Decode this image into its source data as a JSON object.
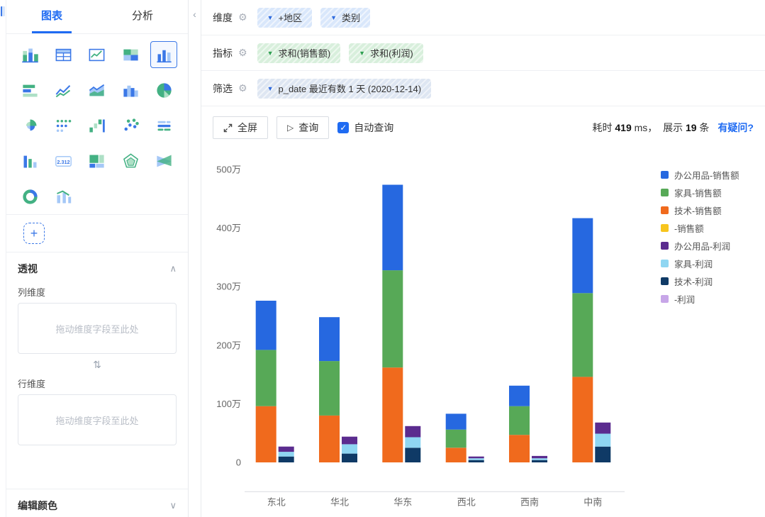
{
  "ui_icons": {
    "gear": "⚙",
    "dropdown": "▼",
    "collapse": "‹",
    "chevron_up": "∧",
    "chevron_down": "∨",
    "swap": "⇅",
    "plus": "+",
    "play": "▷",
    "check": "✓"
  },
  "sidebar": {
    "tabs": [
      {
        "label": "图表"
      },
      {
        "label": "分析"
      }
    ],
    "icons": [
      "stacked-bar-icon",
      "table-icon",
      "trend-table-icon",
      "grid-table-icon",
      "column-chart-icon",
      "bar-horizontal-icon",
      "line-chart-icon",
      "area-chart-icon",
      "histogram-icon",
      "pie-chart-icon",
      "rose-chart-icon",
      "dot-matrix-icon",
      "waterfall-icon",
      "scatter-icon",
      "word-cloud-icon",
      "rank-chart-icon",
      "number-card-icon",
      "treemap-icon",
      "radar-icon",
      "sankey-icon",
      "donut-chart-icon",
      "combo-chart-icon"
    ],
    "selected_index": 4,
    "number_card_text": "2.312",
    "pivot_title": "透视",
    "col_dim_label": "列维度",
    "col_dropzone": "拖动维度字段至此处",
    "row_dim_label": "行维度",
    "row_dropzone": "拖动维度字段至此处",
    "edit_color_label": "编辑颜色"
  },
  "fields": {
    "dimension": {
      "label": "维度",
      "pills": [
        {
          "text": "+地区"
        },
        {
          "text": "类别"
        }
      ]
    },
    "measure": {
      "label": "指标",
      "pills": [
        {
          "text": "求和(销售额)"
        },
        {
          "text": "求和(利润)"
        }
      ]
    },
    "filter": {
      "label": "筛选",
      "pills": [
        {
          "text": "p_date 最近有数 1 天 (2020-12-14)"
        }
      ]
    }
  },
  "toolbar": {
    "fullscreen_label": "全屏",
    "query_label": "查询",
    "auto_query_label": "自动查询",
    "auto_query_checked": true,
    "stats": {
      "prefix": "耗时 ",
      "ms_value": "419",
      "ms_unit": " ms，  ",
      "show_label": "展示 ",
      "count": "19",
      "count_unit": " 条"
    },
    "help": "有疑问?"
  },
  "chart_data": {
    "type": "bar",
    "stacked": true,
    "unit": "万",
    "categories": [
      "东北",
      "华北",
      "华东",
      "西北",
      "西南",
      "中南"
    ],
    "y_ticks": [
      "0",
      "100万",
      "200万",
      "300万",
      "400万",
      "500万"
    ],
    "ylim": [
      -50,
      500
    ],
    "grid": false,
    "legend_position": "right",
    "groups": [
      {
        "stack": "销售额",
        "series": [
          {
            "name": "技术-销售额",
            "color": "#f06a1d",
            "values": [
              96,
              80,
              162,
              25,
              47,
              146
            ]
          },
          {
            "name": "家具-销售额",
            "color": "#57a957",
            "values": [
              96,
              93,
              166,
              31,
              49,
              143
            ]
          },
          {
            "name": "办公用品-销售额",
            "color": "#2668e0",
            "values": [
              84,
              75,
              146,
              27,
              35,
              128
            ]
          },
          {
            "name": "-销售额",
            "color": "#f7c51e",
            "values": [
              0,
              0,
              0,
              0,
              0,
              0
            ]
          }
        ]
      },
      {
        "stack": "利润",
        "series": [
          {
            "name": "技术-利润",
            "color": "#0f3a66",
            "values": [
              10,
              15,
              25,
              4,
              4,
              27
            ]
          },
          {
            "name": "家具-利润",
            "color": "#8fd6f2",
            "values": [
              8,
              16,
              18,
              3,
              3,
              22
            ]
          },
          {
            "name": "办公用品-利润",
            "color": "#5b2c8f",
            "values": [
              9,
              13,
              19,
              3,
              4,
              19
            ]
          },
          {
            "name": "-利润",
            "color": "#c7a6e8",
            "values": [
              0,
              0,
              0,
              0,
              0,
              0
            ]
          }
        ]
      }
    ],
    "legend": [
      {
        "label": "办公用品-销售额",
        "color": "#2668e0"
      },
      {
        "label": "家具-销售额",
        "color": "#57a957"
      },
      {
        "label": "技术-销售额",
        "color": "#f06a1d"
      },
      {
        "label": "-销售额",
        "color": "#f7c51e"
      },
      {
        "label": "办公用品-利润",
        "color": "#5b2c8f"
      },
      {
        "label": "家具-利润",
        "color": "#8fd6f2"
      },
      {
        "label": "技术-利润",
        "color": "#0f3a66"
      },
      {
        "label": "-利润",
        "color": "#c7a6e8"
      }
    ]
  }
}
